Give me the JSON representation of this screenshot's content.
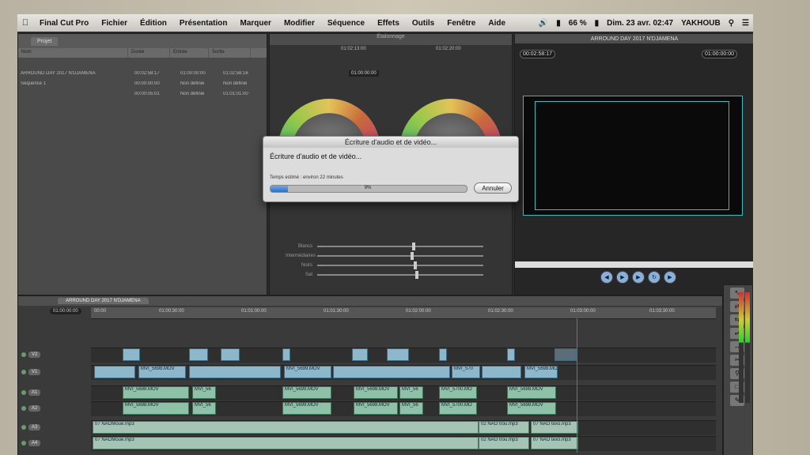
{
  "menubar": {
    "app": "Final Cut Pro",
    "items": [
      "Fichier",
      "Édition",
      "Présentation",
      "Marquer",
      "Modifier",
      "Séquence",
      "Effets",
      "Outils",
      "Fenêtre",
      "Aide"
    ],
    "battery": "66 %",
    "datetime": "Dim. 23 avr.  02:47",
    "user": "YAKHOUB"
  },
  "browser": {
    "tab": "Projet",
    "columns": [
      "Nom",
      "Durée",
      "Entrée",
      "Sortie"
    ],
    "rows": [
      {
        "name": "",
        "dur": "",
        "in": "",
        "out": ""
      },
      {
        "name": "ARROUND DAY 2017 N'DJAMENA",
        "dur": "00:02:58:17",
        "in": "01:00:00:00",
        "out": "01:02:58:16"
      },
      {
        "name": "Séquence 1",
        "dur": "00:00:00:00",
        "in": "Non définie",
        "out": "Non définie"
      },
      {
        "name": "",
        "dur": "00:00:05:01",
        "in": "Non définie",
        "out": "01:01:01:00"
      }
    ]
  },
  "colorpanel": {
    "title": "Étalonnage",
    "timecodes": [
      "01:02:13:00",
      "01:02:20:00"
    ],
    "tc_field": "01:00:00:00",
    "sliders": [
      "Blancs",
      "Intermédiaires",
      "Noirs",
      "Sat"
    ]
  },
  "viewer": {
    "title": "ARROUND DAY 2017 N'DJAMENA",
    "tc_left": "00:02:58:17",
    "tc_right": "01:00:00:00"
  },
  "dialog": {
    "title": "Écriture d'audio et de vidéo...",
    "message": "Écriture d'audio et de vidéo...",
    "estimate": "Temps estimé : environ 22 minutes",
    "progress": 0.09,
    "percent": "9%",
    "cancel": "Annuler"
  },
  "timeline": {
    "tab": "ARROUND DAY 2017 N'DJAMENA",
    "timecode": "01:00:00:00",
    "ticks": [
      "00:00",
      "01:00:30:00",
      "01:01:00:00",
      "01:01:30:00",
      "01:02:00:00",
      "01:02:30:00",
      "01:03:00:00",
      "01:03:30:00"
    ],
    "tracks": [
      "V2",
      "V1",
      "A1",
      "A2",
      "A3",
      "A4"
    ],
    "video_clip_v1": [
      "MVI_5698.MOV",
      "MVI_5699.MOV",
      "MVI_570",
      "MVI_5698.MOV"
    ],
    "audio_clips": [
      "MVI_5698.MOV",
      "MVI_56",
      "MVI_5699.MOV",
      "MVI_5698.MOV",
      "MVI_56",
      "MVI_5700.MO",
      "MVI_5698.MOV"
    ],
    "music_clips": [
      "07 NAOMoue.mp3",
      "02 NAO trou.mp3",
      "07 NAO texo.mp3"
    ]
  },
  "colors": {
    "accent": "#2e6fc4",
    "clip_video": "#8fb7cc",
    "clip_audio": "#8fc0a8",
    "viewer_border": "#2ec0c0"
  }
}
